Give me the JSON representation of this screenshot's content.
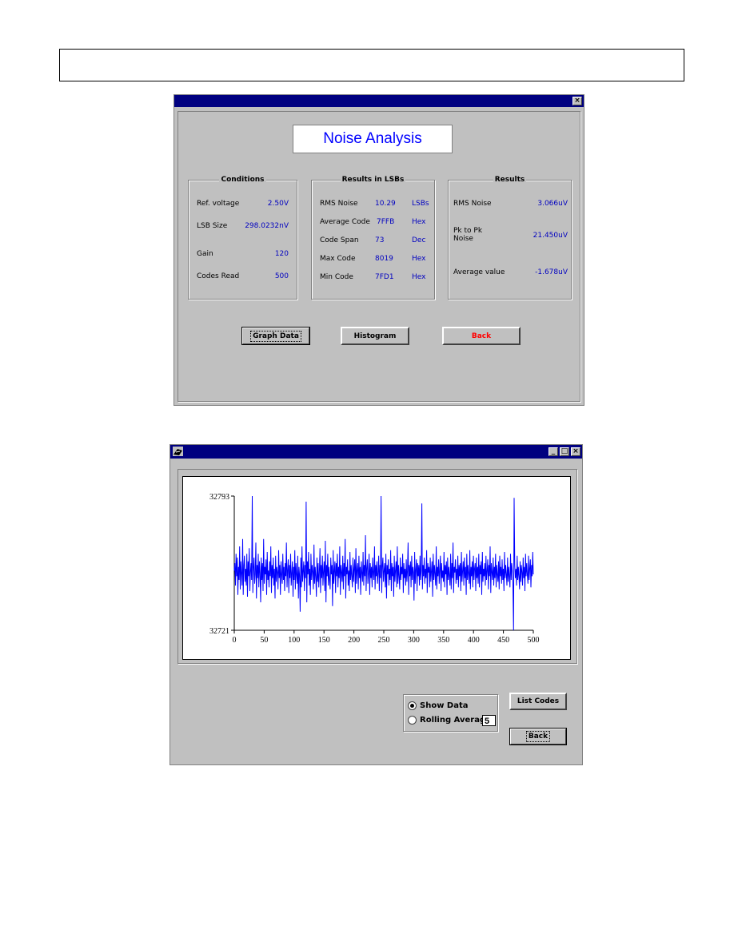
{
  "noise_window": {
    "close_glyph": "×",
    "title": "Noise Analysis",
    "conditions": {
      "group_title": "Conditions",
      "rows": [
        {
          "label": "Ref. voltage",
          "value": "2.50V"
        },
        {
          "label": "LSB Size",
          "value": "298.0232nV"
        },
        {
          "label": "Gain",
          "value": "120"
        },
        {
          "label": "Codes Read",
          "value": "500"
        }
      ]
    },
    "results_lsbs": {
      "group_title": "Results in LSBs",
      "rows": [
        {
          "label": "RMS Noise",
          "value": "10.29",
          "unit": "LSBs"
        },
        {
          "label": "Average Code",
          "value": "7FFB",
          "unit": "Hex"
        },
        {
          "label": "Code Span",
          "value": "73",
          "unit": "Dec"
        },
        {
          "label": "Max Code",
          "value": "8019",
          "unit": "Hex"
        },
        {
          "label": "Min Code",
          "value": "7FD1",
          "unit": "Hex"
        }
      ]
    },
    "results": {
      "group_title": "Results",
      "rows": [
        {
          "label": "RMS Noise",
          "value": "3.066uV"
        },
        {
          "label": "Pk to Pk\nNoise",
          "value": "21.450uV"
        },
        {
          "label": "Average value",
          "value": "-1.678uV"
        }
      ]
    },
    "buttons": {
      "graph_data": "Graph Data",
      "histogram": "Histogram",
      "back": "Back"
    },
    "back_color": "#ff0000"
  },
  "graph_window": {
    "controls": {
      "minimize": "_",
      "maximize": "□",
      "close": "×"
    },
    "show_data_label": "Show Data",
    "rolling_average_label": "Rolling Average",
    "rolling_average_value": "5",
    "list_codes_label": "List Codes",
    "back_label": "Back",
    "line_color": "#0000ff"
  },
  "chart_data": {
    "type": "line",
    "title": "",
    "xlabel": "",
    "ylabel": "",
    "xlim": [
      0,
      500
    ],
    "ylim": [
      32721,
      32793
    ],
    "x_ticks": [
      "0",
      "50",
      "100",
      "150",
      "200",
      "250",
      "300",
      "350",
      "400",
      "450",
      "500"
    ],
    "y_ticks": [
      "32793",
      "32721"
    ],
    "series": [
      {
        "values": [
          32753,
          32757,
          32745,
          32762,
          32750,
          32760,
          32740,
          32755,
          32748,
          32766,
          32743,
          32758,
          32751,
          32745,
          32770,
          32740,
          32756,
          32761,
          32747,
          32754,
          32745,
          32762,
          32739,
          32758,
          32750,
          32765,
          32742,
          32752,
          32757,
          32748,
          32793,
          32741,
          32755,
          32760,
          32746,
          32751,
          32768,
          32738,
          32756,
          32749,
          32762,
          32744,
          32758,
          32752,
          32736,
          32760,
          32748,
          32757,
          32742,
          32770,
          32746,
          32755,
          32751,
          32759,
          32740,
          32763,
          32748,
          32753,
          32744,
          32758,
          32750,
          32766,
          32741,
          32756,
          32749,
          32760,
          32745,
          32754,
          32738,
          32761,
          32747,
          32755,
          32752,
          32743,
          32764,
          32749,
          32756,
          32740,
          32758,
          32751,
          32746,
          32762,
          32748,
          32755,
          32742,
          32757,
          32750,
          32768,
          32744,
          32753,
          32759,
          32741,
          32756,
          32749,
          32762,
          32745,
          32752,
          32758,
          32739,
          32755,
          32748,
          32764,
          32743,
          32757,
          32751,
          32746,
          32761,
          32738,
          32755,
          32750,
          32731,
          32760,
          32744,
          32766,
          32747,
          32753,
          32758,
          32742,
          32756,
          32749,
          32790,
          32736,
          32758,
          32751,
          32763,
          32745,
          32754,
          32740,
          32762,
          32748,
          32756,
          32752,
          32743,
          32767,
          32746,
          32755,
          32750,
          32739,
          32760,
          32747,
          32757,
          32744,
          32752,
          32765,
          32741,
          32756,
          32749,
          32761,
          32745,
          32753,
          32758,
          32742,
          32769,
          32736,
          32756,
          32750,
          32762,
          32745,
          32755,
          32748,
          32743,
          32760,
          32751,
          32756,
          32734,
          32764,
          32746,
          32753,
          32758,
          32741,
          32757,
          32750,
          32762,
          32744,
          32755,
          32749,
          32766,
          32740,
          32756,
          32752,
          32747,
          32761,
          32743,
          32757,
          32750,
          32770,
          32738,
          32755,
          32751,
          32759,
          32745,
          32753,
          32742,
          32763,
          32748,
          32756,
          32750,
          32744,
          32760,
          32747,
          32754,
          32759,
          32741,
          32765,
          32746,
          32753,
          32757,
          32743,
          32761,
          32749,
          32755,
          32740,
          32758,
          32752,
          32747,
          32763,
          32745,
          32756,
          32750,
          32772,
          32742,
          32754,
          32759,
          32746,
          32752,
          32762,
          32740,
          32757,
          32749,
          32755,
          32744,
          32760,
          32751,
          32748,
          32766,
          32743,
          32756,
          32750,
          32758,
          32746,
          32752,
          32761,
          32742,
          32756,
          32749,
          32793,
          32741,
          32755,
          32760,
          32747,
          32753,
          32757,
          32744,
          32762,
          32738,
          32756,
          32751,
          32759,
          32745,
          32754,
          32748,
          32764,
          32742,
          32757,
          32750,
          32755,
          32739,
          32761,
          32747,
          32753,
          32758,
          32744,
          32766,
          32746,
          32756,
          32750,
          32743,
          32760,
          32748,
          32755,
          32751,
          32762,
          32741,
          32757,
          32749,
          32754,
          32745,
          32759,
          32747,
          32753,
          32768,
          32740,
          32756,
          32750,
          32758,
          32744,
          32761,
          32748,
          32755,
          32752,
          32737,
          32763,
          32746,
          32754,
          32759,
          32742,
          32757,
          32750,
          32756,
          32745,
          32761,
          32748,
          32753,
          32789,
          32743,
          32756,
          32750,
          32760,
          32746,
          32754,
          32749,
          32764,
          32741,
          32757,
          32752,
          32755,
          32744,
          32760,
          32747,
          32753,
          32758,
          32739,
          32762,
          32748,
          32756,
          32751,
          32745,
          32766,
          32743,
          32755,
          32750,
          32759,
          32746,
          32754,
          32761,
          32742,
          32757,
          32749,
          32753,
          32747,
          32763,
          32744,
          32756,
          32751,
          32758,
          32740,
          32760,
          32748,
          32755,
          32750,
          32745,
          32762,
          32743,
          32757,
          32749,
          32768,
          32741,
          32755,
          32752,
          32759,
          32746,
          32754,
          32748,
          32761,
          32744,
          32756,
          32750,
          32757,
          32742,
          32763,
          32747,
          32753,
          32758,
          32745,
          32760,
          32749,
          32755,
          32740,
          32762,
          32748,
          32756,
          32751,
          32746,
          32764,
          32743,
          32755,
          32750,
          32758,
          32744,
          32761,
          32748,
          32754,
          32757,
          32742,
          32760,
          32749,
          32755,
          32746,
          32762,
          32744,
          32756,
          32751,
          32758,
          32740,
          32763,
          32747,
          32754,
          32750,
          32757,
          32745,
          32761,
          32748,
          32753,
          32759,
          32743,
          32756,
          32750,
          32766,
          32741,
          32757,
          32752,
          32748,
          32760,
          32745,
          32755,
          32749,
          32762,
          32744,
          32756,
          32751,
          32747,
          32758,
          32743,
          32761,
          32750,
          32755,
          32746,
          32759,
          32748,
          32754,
          32742,
          32763,
          32749,
          32756,
          32751,
          32745,
          32760,
          32747,
          32755,
          32750,
          32744,
          32762,
          32748,
          32757,
          32752,
          32746,
          32721,
          32792,
          32756,
          32749,
          32754,
          32745,
          32761,
          32748,
          32755,
          32750,
          32743,
          32758,
          32747,
          32756,
          32752,
          32745,
          32760,
          32749,
          32755,
          32742,
          32762,
          32750,
          32757,
          32751,
          32746,
          32761,
          32748,
          32754,
          32759,
          32744,
          32756,
          32750,
          32763,
          32751
        ]
      }
    ],
    "grid": false
  }
}
